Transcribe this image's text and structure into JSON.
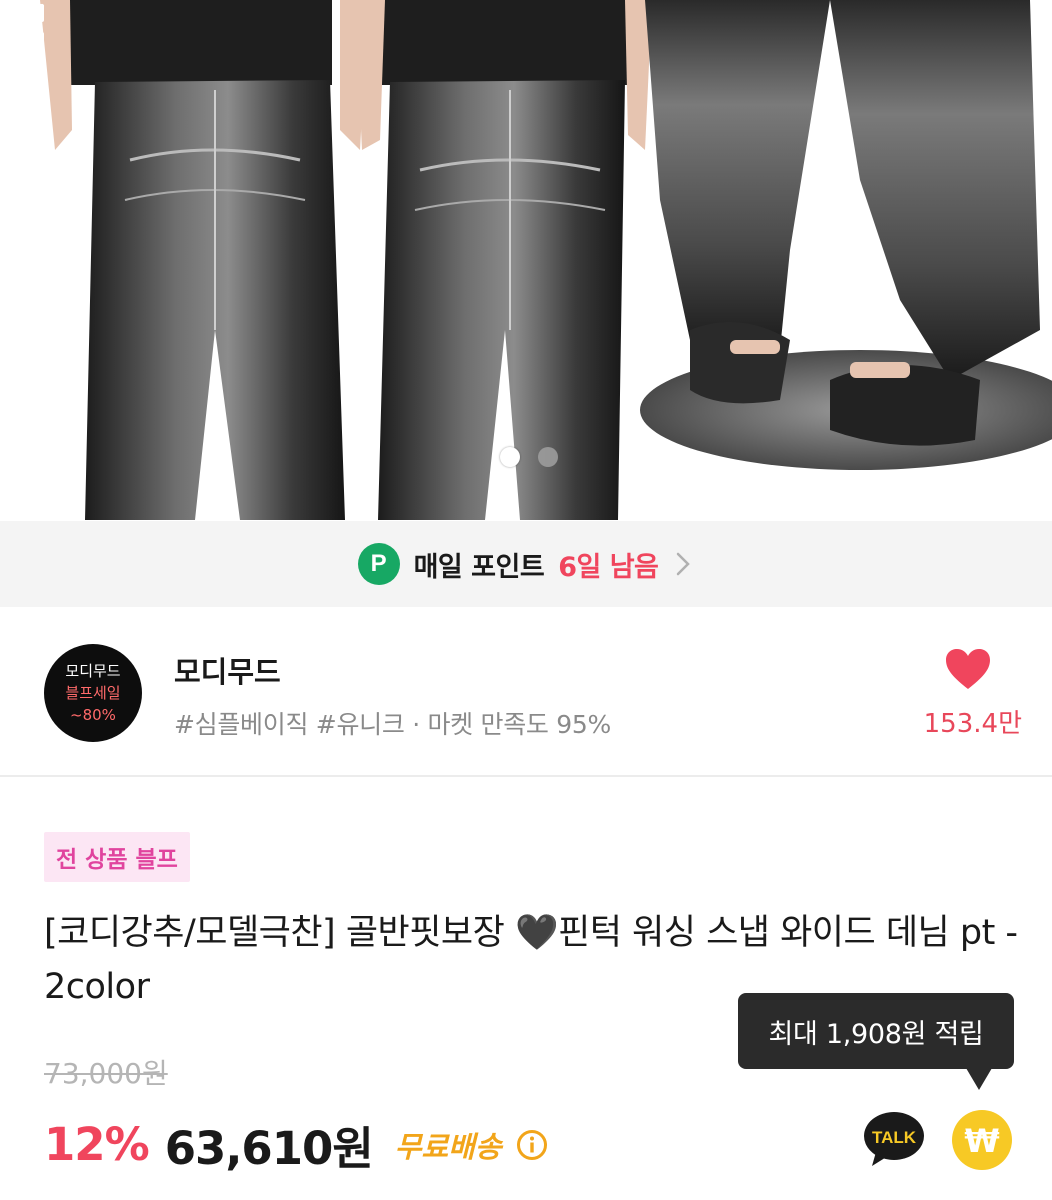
{
  "carousel": {
    "current_index": 1,
    "total": 2
  },
  "point_banner": {
    "badge": "P",
    "label": "매일 포인트",
    "days_left": "6일 남음"
  },
  "shop": {
    "logo_lines": [
      "모디무드",
      "블프세일",
      "~80%"
    ],
    "name": "모디무드",
    "tags": "#심플베이직 #유니크 · 마켓 만족도 95%",
    "like_count": "153.4만"
  },
  "product": {
    "promo_badge": "전 상품 블프",
    "title": "[코디강추/모델극찬] 골반핏보장 🖤핀턱 워싱 스냅 와이드 데님 pt - 2color",
    "original_price": "73,000원",
    "discount": "12%",
    "price": "63,610원",
    "shipping": "무료배송"
  },
  "tooltip": {
    "text": "최대 1,908원 적립"
  },
  "buttons": {
    "talk_label": "TALK",
    "won_symbol": "₩"
  },
  "colors": {
    "accent_red": "#f0455d",
    "point_green": "#17a864",
    "shipping_orange": "#f2a51a",
    "promo_pink": "#e0449e",
    "coin_yellow": "#f7c925"
  }
}
